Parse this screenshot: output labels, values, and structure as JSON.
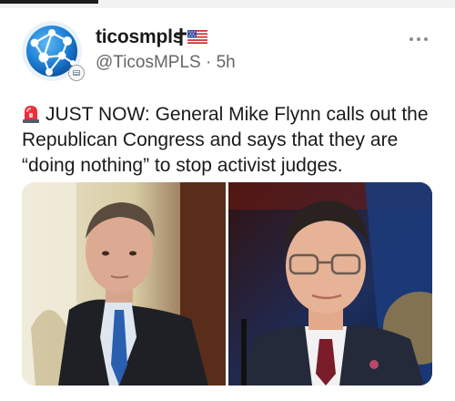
{
  "post": {
    "display_name": "ticosmpls",
    "handle": "@TicosMPLS",
    "separator": " · ",
    "time": "5h",
    "text": "JUST NOW: General Mike Flynn calls out the Republican Congress and says that they are “doing nothing” to stop activist judges.",
    "name_icons": [
      "cross-icon",
      "us-flag-icon"
    ],
    "text_icon": "siren-icon",
    "more_icon": "more-options-icon"
  },
  "media": {
    "image_count": 2,
    "icons": [
      "photo-left",
      "photo-right"
    ]
  },
  "colors": {
    "name": "#1a1a1a",
    "secondary": "#666666",
    "background": "#ffffff",
    "avatar_blue": "#1d7fd4"
  }
}
